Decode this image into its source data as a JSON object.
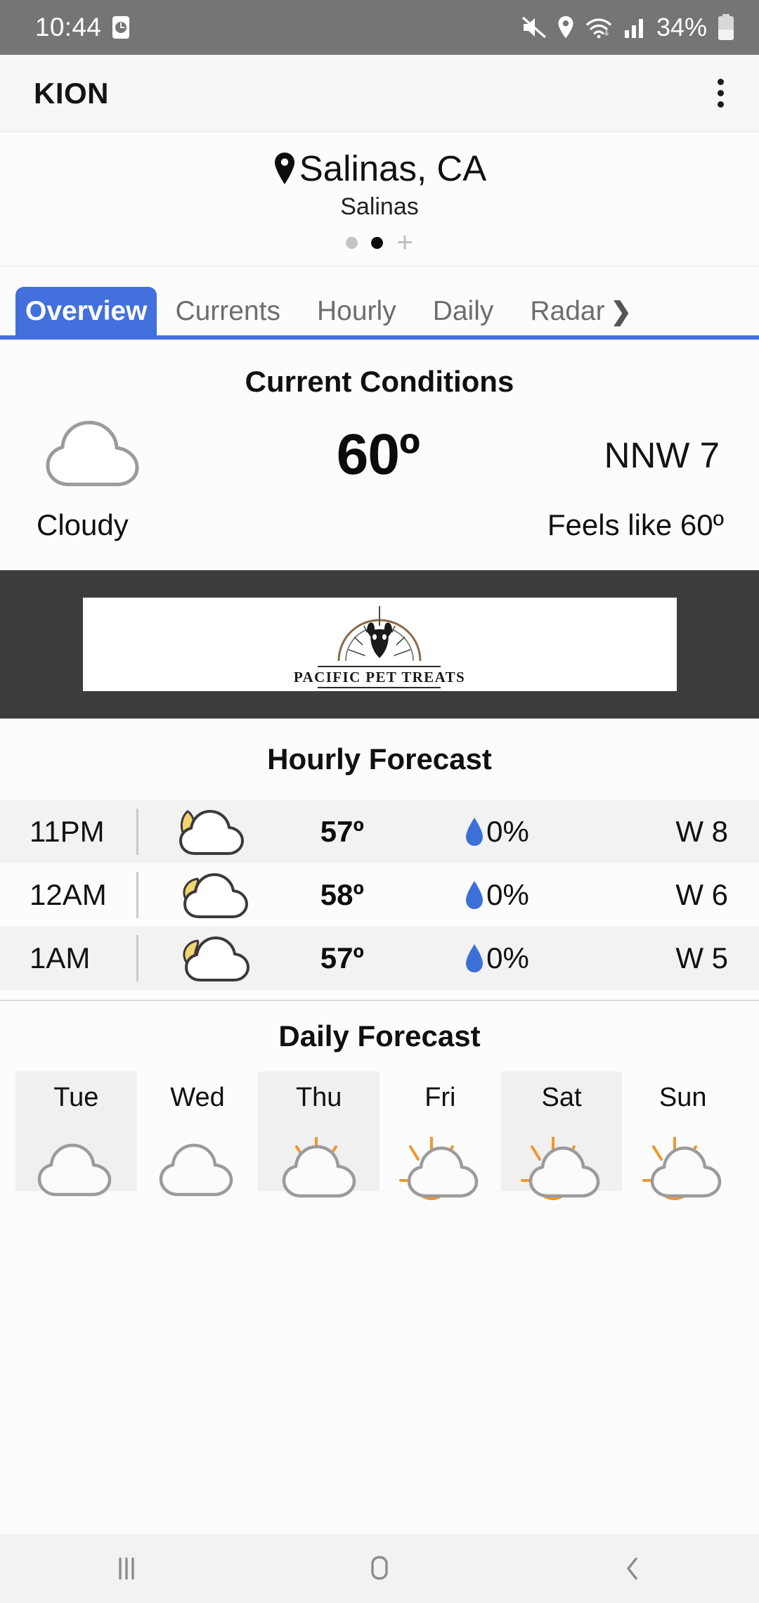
{
  "status_bar": {
    "time": "10:44",
    "battery_percent": "34%",
    "icons": [
      "alarm-icon",
      "mute-icon",
      "location-icon",
      "wifi-icon",
      "signal-icon",
      "battery-icon"
    ]
  },
  "app_bar": {
    "title": "KION",
    "menu_icon": "overflow-menu-icon"
  },
  "location": {
    "pin_icon": "location-pin-icon",
    "name": "Salinas, CA",
    "sub": "Salinas",
    "dots": [
      {
        "active": false
      },
      {
        "active": true
      }
    ],
    "add_label": "+"
  },
  "tabs": [
    {
      "label": "Overview",
      "active": true
    },
    {
      "label": "Currents",
      "active": false
    },
    {
      "label": "Hourly",
      "active": false
    },
    {
      "label": "Daily",
      "active": false
    },
    {
      "label": "Radar",
      "active": false,
      "chevron": "❯"
    }
  ],
  "current_conditions": {
    "title": "Current Conditions",
    "icon": "cloud-icon",
    "temperature": "60º",
    "wind": "NNW  7",
    "condition": "Cloudy",
    "feels_like": "Feels like 60º"
  },
  "ad": {
    "advertiser": "PACIFIC PET TREATS",
    "logo_icon": "dog-head-arch-logo"
  },
  "hourly": {
    "title": "Hourly Forecast",
    "rows": [
      {
        "time": "11PM",
        "icon": "moon-behind-cloud-icon",
        "temp": "57º",
        "pop": "0%",
        "wind": "W  8"
      },
      {
        "time": "12AM",
        "icon": "moon-behind-cloud-icon",
        "temp": "58º",
        "pop": "0%",
        "wind": "W  6"
      },
      {
        "time": "1AM",
        "icon": "moon-behind-cloud-icon",
        "temp": "57º",
        "pop": "0%",
        "wind": "W  5"
      }
    ]
  },
  "daily": {
    "title": "Daily Forecast",
    "days": [
      {
        "name": "Tue",
        "icon": "cloud-icon"
      },
      {
        "name": "Wed",
        "icon": "cloud-icon"
      },
      {
        "name": "Thu",
        "icon": "sun-behind-cloud-small-icon"
      },
      {
        "name": "Fri",
        "icon": "sun-behind-cloud-icon"
      },
      {
        "name": "Sat",
        "icon": "sun-behind-cloud-icon"
      },
      {
        "name": "Sun",
        "icon": "sun-behind-cloud-icon"
      }
    ]
  },
  "nav_bar": {
    "recents_icon": "recents-icon",
    "home_icon": "home-icon",
    "back_icon": "back-icon"
  },
  "colors": {
    "accent_blue": "#4270dc",
    "droplet_blue": "#3d6fd8",
    "sun_orange": "#f0962e",
    "moon_yellow": "#f2d671",
    "ad_band": "#3d3d3d",
    "status_bar": "#757575"
  }
}
